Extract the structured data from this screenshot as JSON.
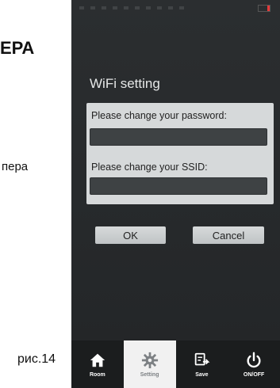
{
  "document": {
    "heading_fragment": "ЕРА",
    "body_fragment": "пера",
    "caption": "рис.14"
  },
  "screen": {
    "title": "WiFi setting",
    "password_label": "Please change your password:",
    "password_value": "",
    "ssid_label": "Please change your SSID:",
    "ssid_value": "",
    "ok_label": "OK",
    "cancel_label": "Cancel"
  },
  "nav": {
    "items": [
      {
        "label": "Room",
        "icon": "home-icon"
      },
      {
        "label": "Setting",
        "icon": "gear-icon"
      },
      {
        "label": "Save",
        "icon": "save-icon"
      },
      {
        "label": "ON/OFF",
        "icon": "power-icon"
      }
    ],
    "active_index": 1
  }
}
